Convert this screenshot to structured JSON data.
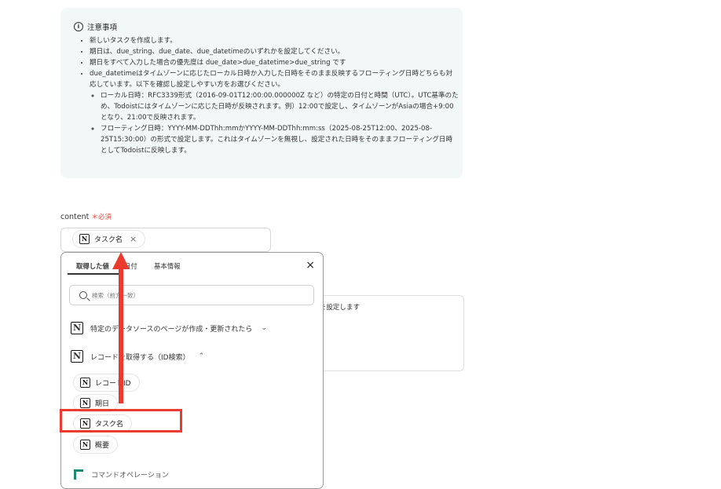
{
  "notice": {
    "title": "注意事項",
    "items": [
      "新しいタスクを作成します。",
      "期日は、due_string、due_date、due_datetimeのいずれかを設定してください。",
      "期日をすべて入力した場合の優先度は due_date>due_datetime>due_string です",
      "due_datetimeはタイムゾーンに応じたローカル日時か入力した日時をそのまま反映するフローティング日時どちらも対応しています。以下を確認し設定しやすい方をお選びください。"
    ],
    "subitems": [
      "ローカル日時：RFC3339形式（2016-09-01T12:00:00.000000Z など）の特定の日付と時間（UTC）。UTC基準のため、Todoistにはタイムゾーンに応じた日時が反映されます。例）12:00で設定し、タイムゾーンがAsiaの場合+9:00となり、21:00で反映されます。",
      "フローティング日時：YYYY-MM-DDThh:mmかYYYY-MM-DDThh:mm:ss（2025-08-25T12:00、2025-08-25T15:30:00）の形式で設定します。これはタイムゾーンを無視し、設定された日時をそのままフローティング日時としてTodoistに反映します。"
    ]
  },
  "field": {
    "label": "content",
    "required": "必須",
    "chip_label": "タスク名"
  },
  "background_hint": "ーを設定します",
  "popup": {
    "tabs": [
      "取得した値",
      "日付",
      "基本情報"
    ],
    "search_placeholder": "検索（前方一致）",
    "sections": [
      {
        "label": "特定のデータソースのページが作成・更新されたら",
        "expanded": false
      },
      {
        "label": "レコードを取得する（ID検索）",
        "expanded": true
      }
    ],
    "items": [
      "レコードID",
      "期日",
      "タスク名",
      "概要"
    ],
    "last_row": "コマンドオペレーション"
  },
  "icons": {
    "notion": "N",
    "close": "×",
    "chevron_down": "⌄",
    "chevron_up": "⌃"
  },
  "colors": {
    "annotation": "#ec3a2f",
    "notice_bg": "#f2f8f8",
    "required": "#e8443a"
  }
}
